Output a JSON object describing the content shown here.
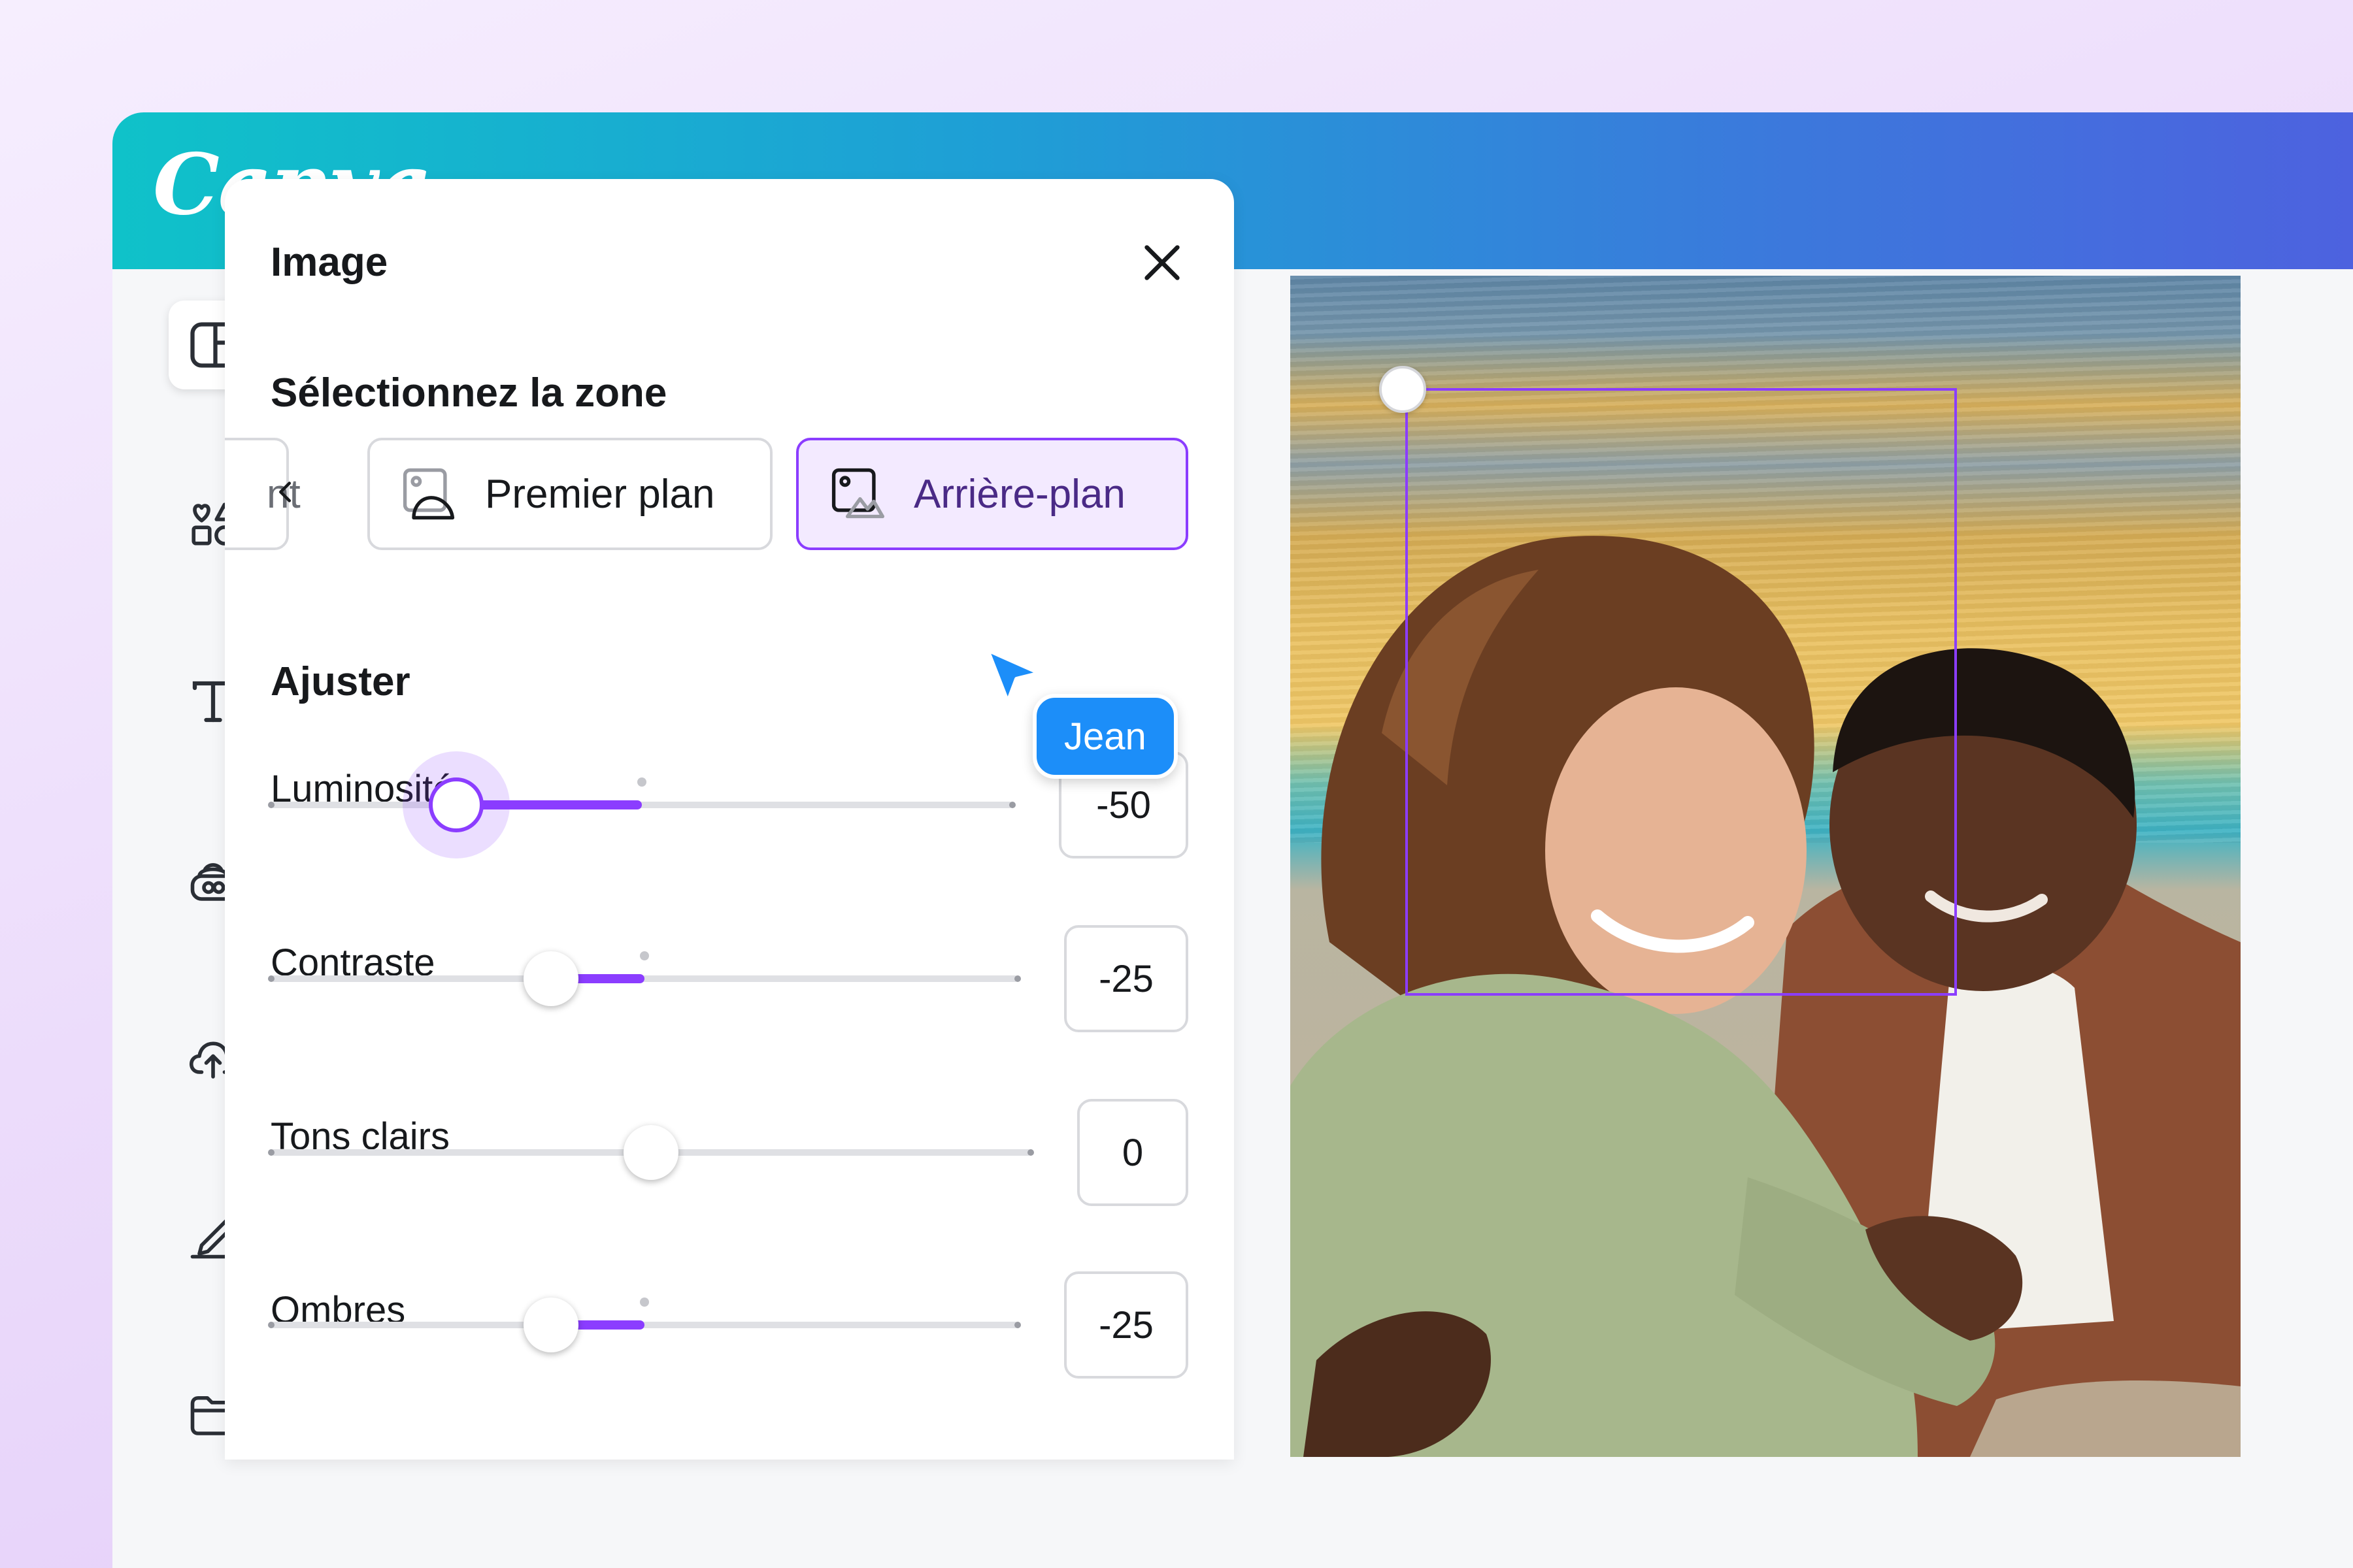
{
  "app": {
    "logo": "Canva"
  },
  "sidebar": {
    "items": [
      {
        "icon": "layout-icon",
        "active": true
      },
      {
        "icon": "elements-icon",
        "active": false
      },
      {
        "icon": "text-icon",
        "active": false
      },
      {
        "icon": "brand-icon",
        "active": false
      },
      {
        "icon": "upload-cloud-icon",
        "active": false
      },
      {
        "icon": "draw-icon",
        "active": false
      },
      {
        "icon": "folder-icon",
        "active": false
      }
    ]
  },
  "panel": {
    "title": "Image",
    "zone_section": {
      "title": "Sélectionnez la zone",
      "chips": [
        {
          "label": "nt"
        },
        {
          "label": "Premier plan"
        },
        {
          "label": "Arrière-plan",
          "selected": true
        }
      ]
    },
    "adjust_section": {
      "title": "Ajuster",
      "sliders": [
        {
          "label": "Luminosité",
          "value": "-50",
          "level": -50
        },
        {
          "label": "Contraste",
          "value": "-25",
          "level": -25
        },
        {
          "label": "Tons clairs",
          "value": "0",
          "level": 0
        },
        {
          "label": "Ombres",
          "value": "-25",
          "level": -25
        }
      ]
    }
  },
  "collaborator": {
    "name": "Jean"
  },
  "colors": {
    "accent": "#8b3dff",
    "collaborator": "#1c8ef9"
  }
}
